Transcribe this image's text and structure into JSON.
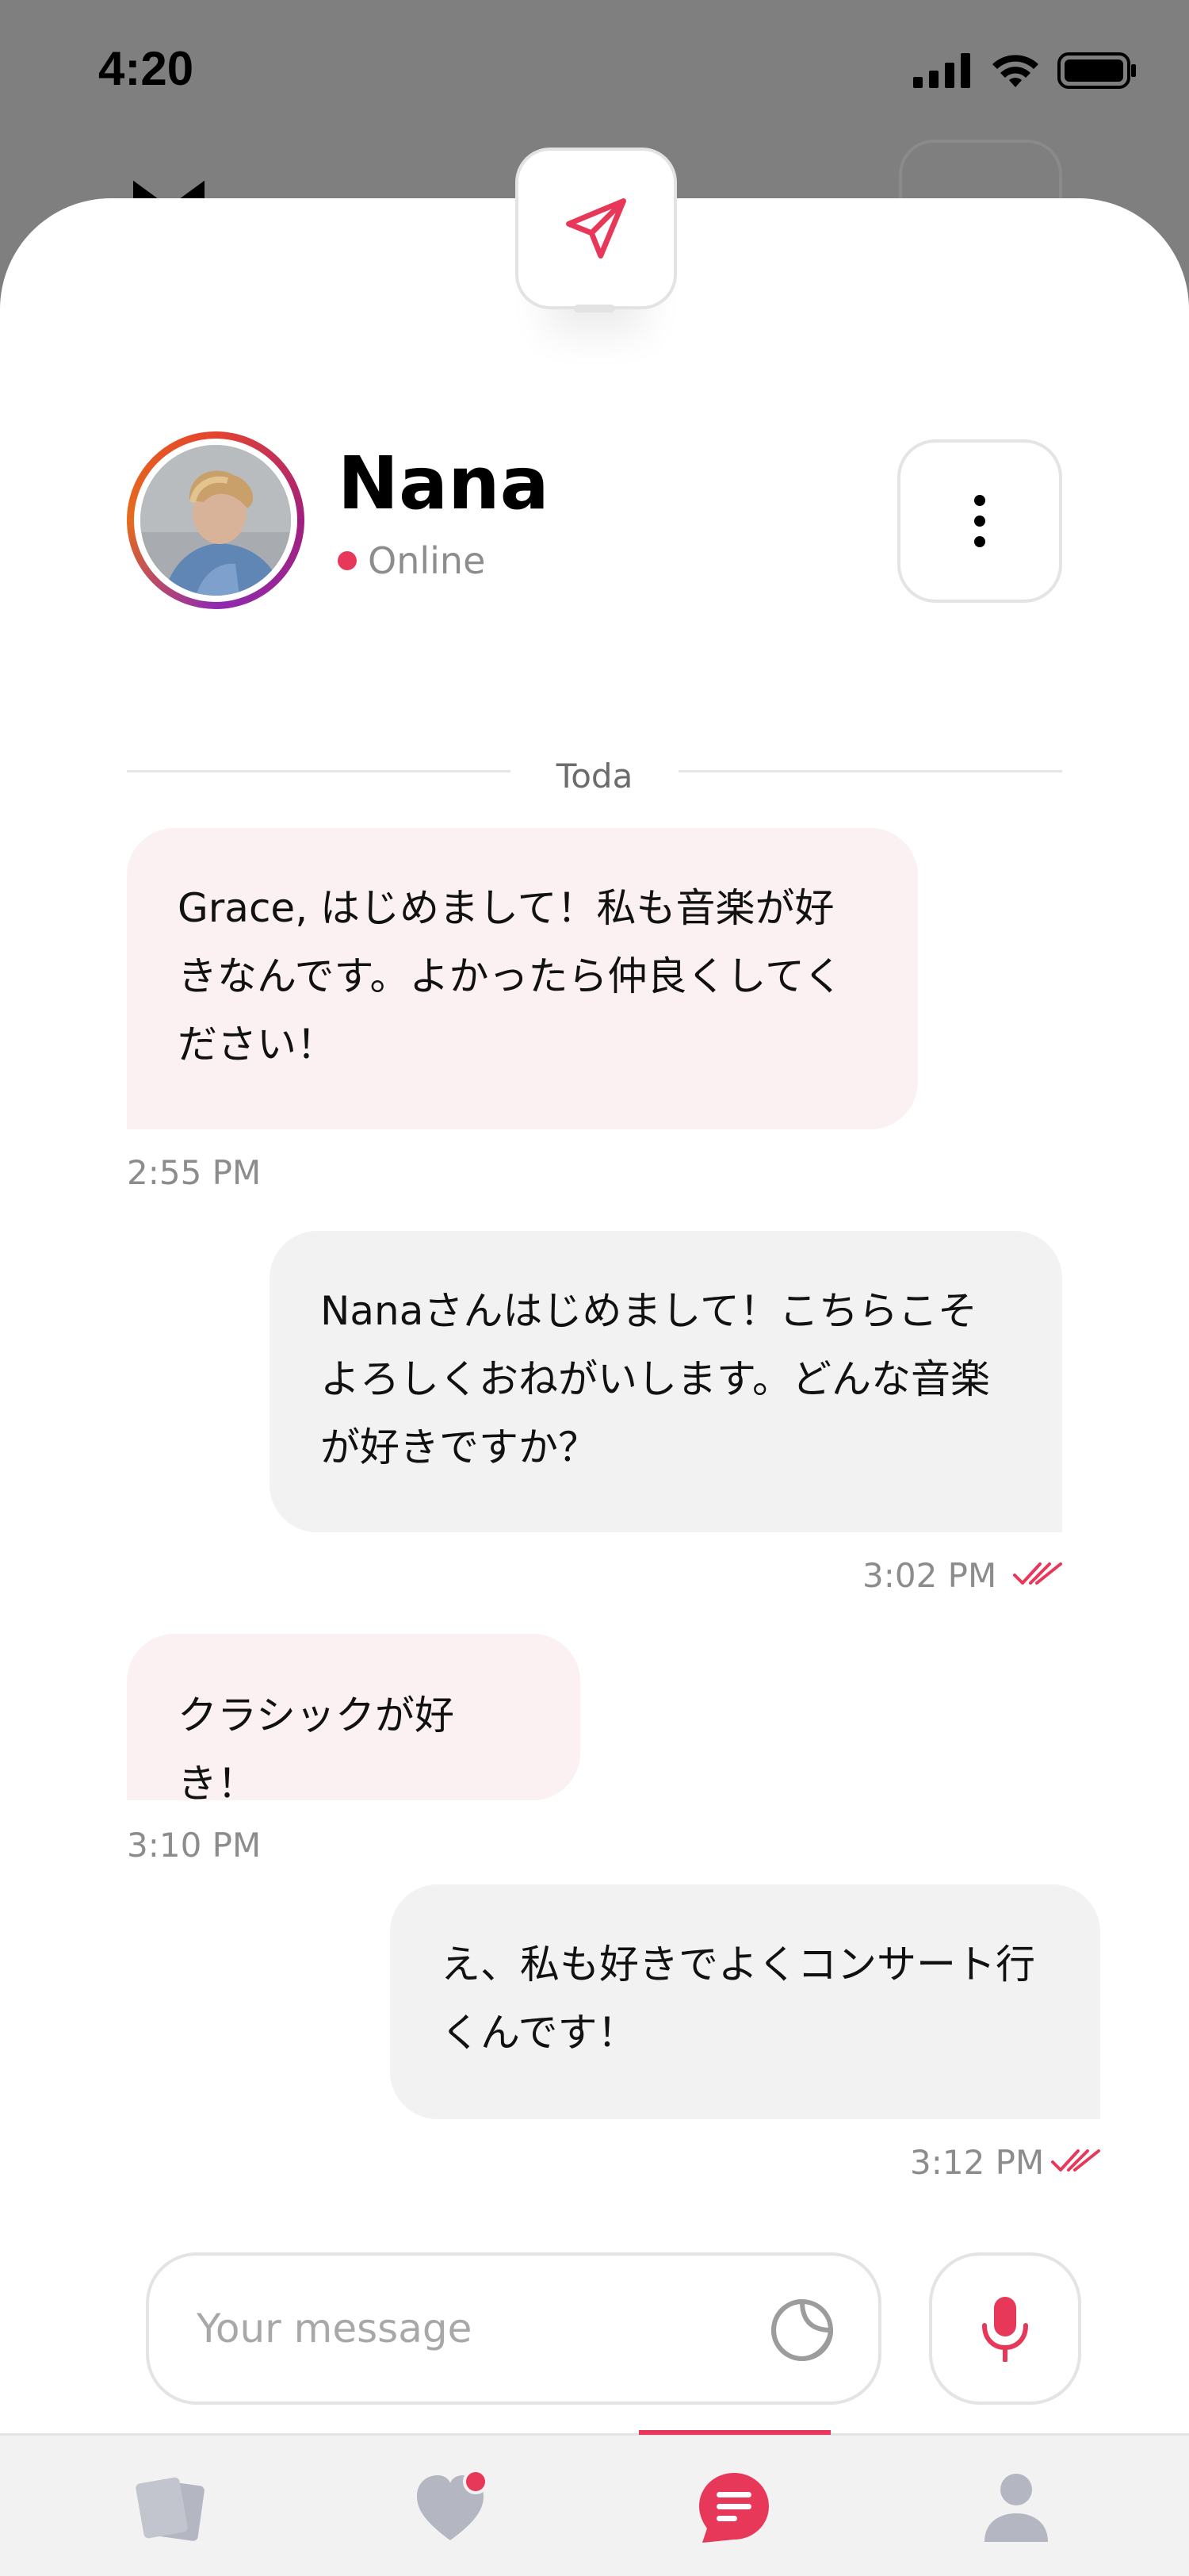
{
  "status_bar": {
    "time": "4:20"
  },
  "header": {
    "contact_name": "Nana",
    "status": "Online",
    "status_color": "#e8385a"
  },
  "divider": {
    "label": "Today"
  },
  "messages": [
    {
      "direction": "incoming",
      "text": "Grace, はじめまして！私も音楽が好きなんです。よかったら仲良くしてください！",
      "time": "2:55 PM",
      "read": false
    },
    {
      "direction": "outgoing",
      "text": "Nanaさんはじめまして！こちらこそよろしくおねがいします。どんな音楽が好きですか？",
      "time": "3:02 PM",
      "read": true
    },
    {
      "direction": "incoming",
      "text": "クラシックが好き！",
      "time": "3:10 PM",
      "read": false
    },
    {
      "direction": "outgoing",
      "text": "え、私も好きでよくコンサート行くんです！",
      "time": "3:12 PM",
      "read": true
    }
  ],
  "composer": {
    "placeholder": "Your message"
  },
  "tabs": [
    {
      "name": "cards",
      "icon": "cards-icon",
      "active": false
    },
    {
      "name": "likes",
      "icon": "heart-icon",
      "active": false,
      "badge": true
    },
    {
      "name": "messages",
      "icon": "chat-icon",
      "active": true
    },
    {
      "name": "profile",
      "icon": "person-icon",
      "active": false
    }
  ],
  "colors": {
    "accent": "#e8385a",
    "incoming_bubble": "#fbf0f2",
    "outgoing_bubble": "#f2f2f2",
    "inactive_icon": "#b4b6c2"
  }
}
